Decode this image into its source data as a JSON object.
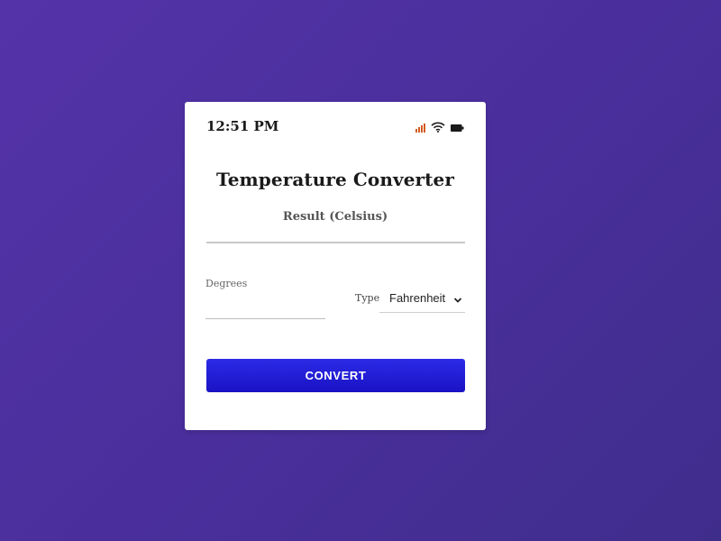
{
  "status_bar": {
    "time": "12:51 PM",
    "icons": [
      "signal-icon",
      "wifi-icon",
      "battery-icon"
    ],
    "signal_color": "#d35b1f"
  },
  "app": {
    "title": "Temperature Converter",
    "result_label": "Result (Celsius)"
  },
  "form": {
    "degrees_label": "Degrees",
    "degrees_value": "",
    "type_label": "Type",
    "type_selected": "Fahrenheit",
    "convert_label": "CONVERT"
  },
  "colors": {
    "background": "#4a2f9c",
    "button": "#1f17d4",
    "card": "#ffffff"
  }
}
